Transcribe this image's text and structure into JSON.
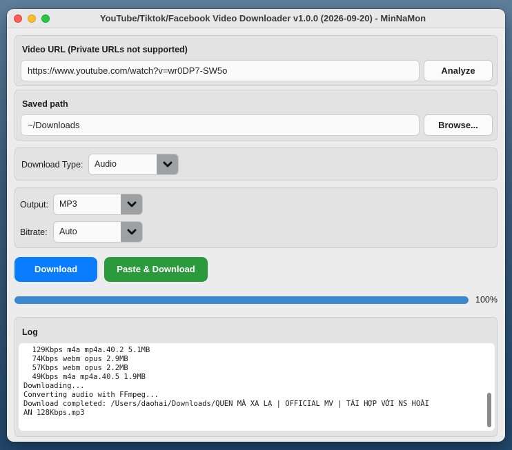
{
  "window": {
    "title": "YouTube/Tiktok/Facebook Video Downloader v1.0.0 (2026-09-20) - MinNaMon"
  },
  "video_url": {
    "label": "Video URL (Private URLs not supported)",
    "value": "https://www.youtube.com/watch?v=wr0DP7-SW5o",
    "analyze_label": "Analyze"
  },
  "saved_path": {
    "label": "Saved path",
    "value": "~/Downloads",
    "browse_label": "Browse..."
  },
  "download_type": {
    "label": "Download Type:",
    "selected": "Audio"
  },
  "output": {
    "label": "Output:",
    "selected": "MP3"
  },
  "bitrate": {
    "label": "Bitrate:",
    "selected": "Auto"
  },
  "actions": {
    "download_label": "Download",
    "download_color": "#0a7cff",
    "paste_download_label": "Paste & Download",
    "paste_download_color": "#2b9a3c"
  },
  "progress": {
    "percent": 100,
    "label": "100%"
  },
  "log": {
    "label": "Log",
    "lines": [
      "  129Kbps m4a mp4a.40.2 5.1MB",
      "  74Kbps webm opus 2.9MB",
      "  57Kbps webm opus 2.2MB",
      "  49Kbps m4a mp4a.40.5 1.9MB",
      "Downloading...",
      "Converting audio with FFmpeg...",
      "Download completed: /Users/daohai/Downloads/QUEN MÀ XA LẠ | OFFICIAL MV | TÁI HỢP VỚI NS HOÀI",
      "AN 128Kbps.mp3"
    ]
  }
}
